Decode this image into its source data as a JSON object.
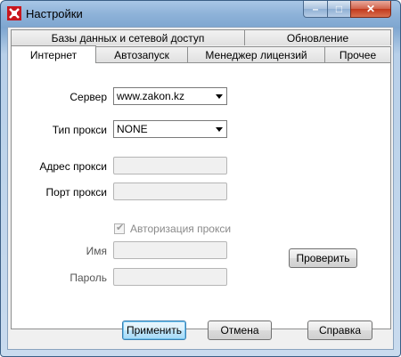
{
  "window": {
    "title": "Настройки",
    "controls": {
      "minimize": "–",
      "maximize": "□",
      "close": "✕"
    }
  },
  "tabs": {
    "row1": [
      {
        "label": "Базы данных и сетевой доступ"
      },
      {
        "label": "Обновление"
      }
    ],
    "row2": [
      {
        "label": "Интернет",
        "active": true
      },
      {
        "label": "Автозапуск"
      },
      {
        "label": "Менеджер лицензий"
      },
      {
        "label": "Прочее"
      }
    ]
  },
  "form": {
    "server_label": "Сервер",
    "server_value": "www.zakon.kz",
    "proxy_type_label": "Тип прокси",
    "proxy_type_value": "NONE",
    "proxy_address_label": "Адрес прокси",
    "proxy_address_value": "",
    "proxy_port_label": "Порт прокси",
    "proxy_port_value": "",
    "proxy_auth_label": "Авторизация прокси",
    "proxy_auth_checked": true,
    "name_label": "Имя",
    "name_value": "",
    "password_label": "Пароль",
    "password_value": "",
    "check_button": "Проверить"
  },
  "footer": {
    "apply": "Применить",
    "cancel": "Отмена",
    "help": "Справка"
  }
}
